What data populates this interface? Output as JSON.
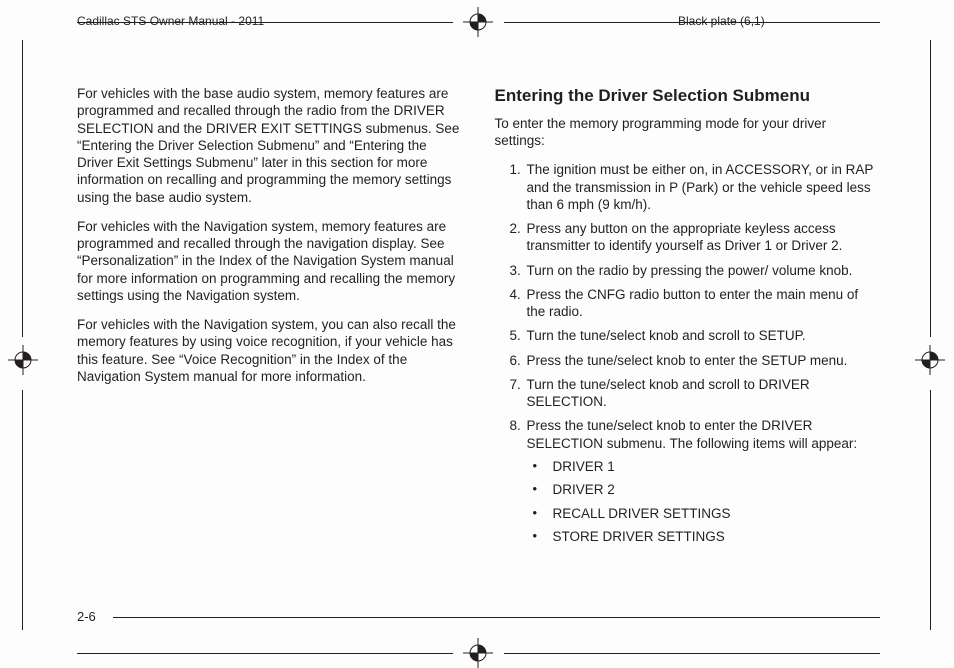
{
  "header": {
    "left": "Cadillac STS Owner Manual - 2011",
    "right": "Black plate (6,1)"
  },
  "left_column": {
    "p1": "For vehicles with the base audio system, memory features are programmed and recalled through the radio from the DRIVER SELECTION and the DRIVER EXIT SETTINGS submenus. See “Entering the Driver Selection Submenu” and “Entering the Driver Exit Settings Submenu” later in this section for more information on recalling and programming the memory settings using the base audio system.",
    "p2": "For vehicles with the Navigation system, memory features are programmed and recalled through the navigation display. See “Personalization” in the Index of the Navigation System manual for more information on programming and recalling the memory settings using the Navigation system.",
    "p3": "For vehicles with the Navigation system, you can also recall the memory features by using voice recognition, if your vehicle has this feature. See “Voice Recognition” in the Index of the Navigation System manual for more information."
  },
  "right_column": {
    "heading": "Entering the Driver Selection Submenu",
    "intro": "To enter the memory programming mode for your driver settings:",
    "steps": [
      "The ignition must be either on, in ACCESSORY, or in RAP and the transmission in P (Park) or the vehicle speed less than 6 mph (9 km/h).",
      "Press any button on the appropriate keyless access transmitter to identify yourself as Driver 1 or Driver 2.",
      "Turn on the radio by pressing the power/ volume knob.",
      "Press the CNFG radio button to enter the main menu of the radio.",
      "Turn the tune/select knob and scroll to SETUP.",
      "Press the tune/select knob to enter the SETUP menu.",
      "Turn the tune/select knob and scroll to DRIVER SELECTION.",
      "Press the tune/select knob to enter the DRIVER SELECTION submenu. The following items will appear:"
    ],
    "bullets": [
      "DRIVER 1",
      "DRIVER 2",
      "RECALL DRIVER SETTINGS",
      "STORE DRIVER SETTINGS"
    ]
  },
  "page_number": "2-6"
}
